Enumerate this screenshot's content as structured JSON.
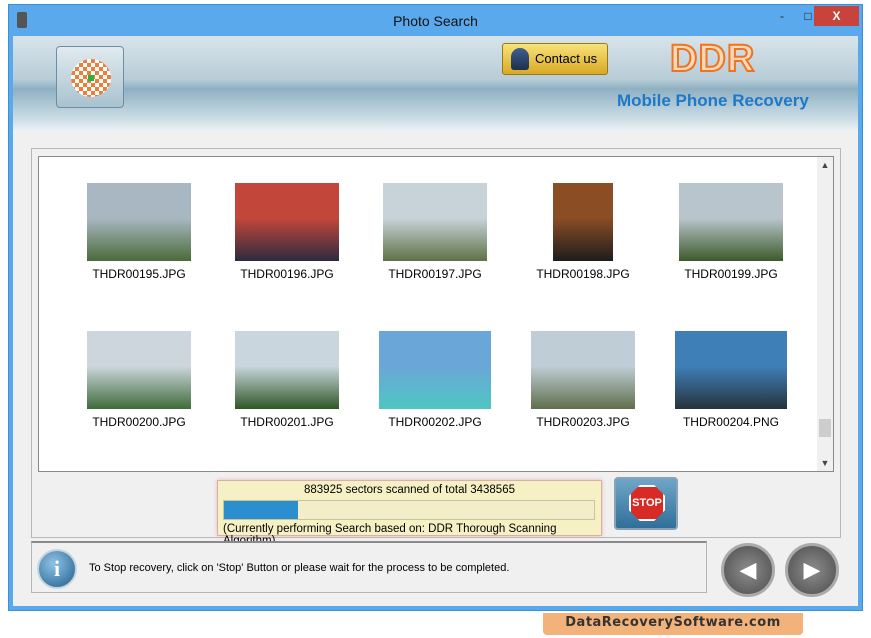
{
  "window": {
    "title": "Photo Search",
    "minimize": "-",
    "maximize": "□",
    "close": "X"
  },
  "header": {
    "contact_label": "Contact us",
    "brand": "DDR",
    "product": "Mobile Phone Recovery"
  },
  "gallery": {
    "items": [
      {
        "name": "THDR00195.JPG",
        "colors": [
          "#a9b7c2",
          "#4a6b3a"
        ]
      },
      {
        "name": "THDR00196.JPG",
        "colors": [
          "#c2473a",
          "#2b2b3e"
        ]
      },
      {
        "name": "THDR00197.JPG",
        "colors": [
          "#c8d3d9",
          "#5e7247"
        ]
      },
      {
        "name": "THDR00198.JPG",
        "colors": [
          "#8a4d24",
          "#1d1d1d"
        ]
      },
      {
        "name": "THDR00199.JPG",
        "colors": [
          "#b9c5cc",
          "#3c5a2a"
        ]
      },
      {
        "name": "THDR00200.JPG",
        "colors": [
          "#cdd6dd",
          "#3f6b3a"
        ]
      },
      {
        "name": "THDR00201.JPG",
        "colors": [
          "#c9d6de",
          "#2f5726"
        ]
      },
      {
        "name": "THDR00202.JPG",
        "colors": [
          "#6aa7d8",
          "#4fc6c4"
        ]
      },
      {
        "name": "THDR00203.JPG",
        "colors": [
          "#bfcdd6",
          "#5f6f4c"
        ]
      },
      {
        "name": "THDR00204.PNG",
        "colors": [
          "#3f7fb8",
          "#26333a"
        ]
      }
    ]
  },
  "progress": {
    "status": "883925 sectors scanned of total 3438565",
    "fraction": 0.2,
    "algorithm": "(Currently performing Search based on:  DDR Thorough Scanning Algorithm)",
    "stop_label": "STOP"
  },
  "info": {
    "message": "To Stop recovery, click on 'Stop' Button or please wait for the process to be completed."
  },
  "footer": {
    "brand": "DataRecoverySoftware.com"
  }
}
